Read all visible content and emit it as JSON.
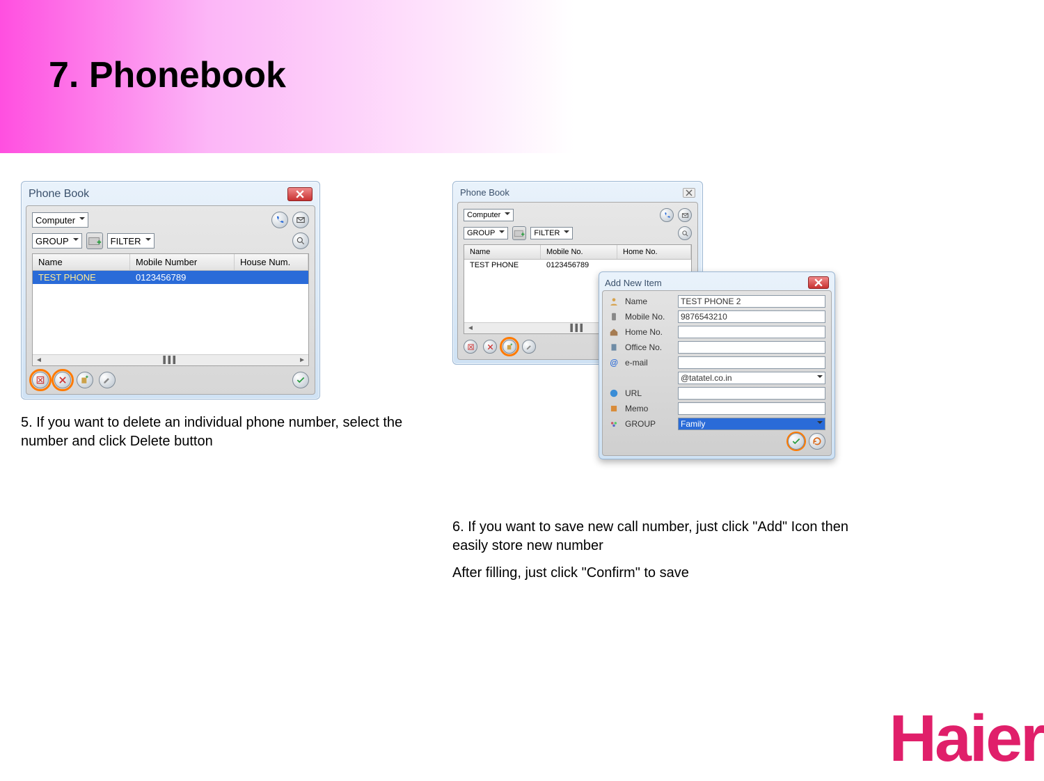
{
  "page": {
    "title": "7. Phonebook"
  },
  "left": {
    "window_title": "Phone Book",
    "location_dropdown": "Computer",
    "group_label": "GROUP",
    "filter_label": "FILTER",
    "columns": {
      "name": "Name",
      "mobile": "Mobile Number",
      "house": "House Num."
    },
    "rows": [
      {
        "name": "TEST PHONE",
        "mobile": "0123456789",
        "house": ""
      }
    ],
    "caption": "5. If you want to delete an individual phone number, select the number and click Delete button"
  },
  "right": {
    "window_title": "Phone Book",
    "location_dropdown": "Computer",
    "group_label": "GROUP",
    "filter_label": "FILTER",
    "columns": {
      "name": "Name",
      "mobile": "Mobile No.",
      "home": "Home No."
    },
    "rows": [
      {
        "name": "TEST PHONE",
        "mobile": "0123456789",
        "home": ""
      }
    ],
    "add_dialog": {
      "title": "Add New Item",
      "fields": {
        "name_label": "Name",
        "name_value": "TEST PHONE 2",
        "mobile_label": "Mobile No.",
        "mobile_value": "9876543210",
        "home_label": "Home No.",
        "home_value": "",
        "office_label": "Office No.",
        "office_value": "",
        "email_label": "e-mail",
        "email_value": "",
        "email_domain": "@tatatel.co.in",
        "url_label": "URL",
        "url_value": "",
        "memo_label": "Memo",
        "memo_value": "",
        "group_label": "GROUP",
        "group_value": "Family"
      }
    },
    "caption1": "6. If you want to save new call number, just click \"Add\" Icon then easily store new number",
    "caption2": "After filling, just click \"Confirm\" to save"
  },
  "logo_text": "Haier"
}
